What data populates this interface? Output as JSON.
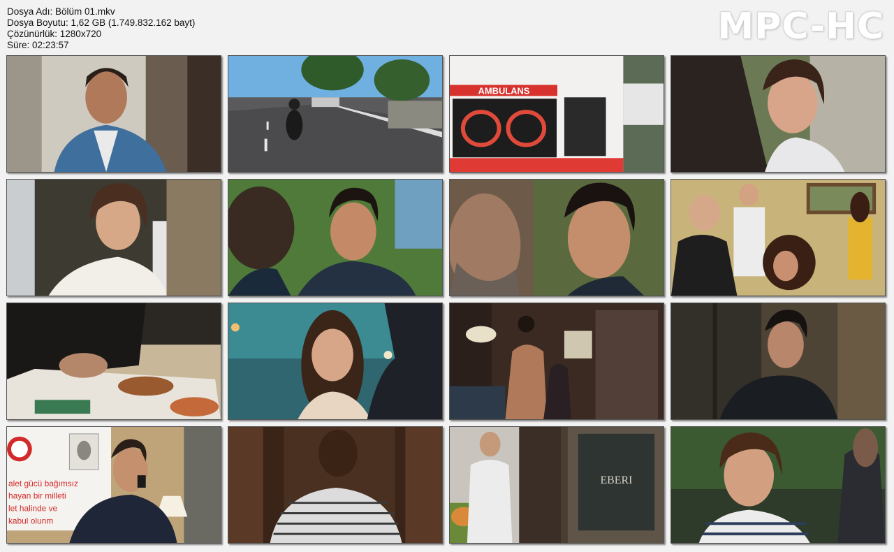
{
  "info": {
    "file_name": "Dosya Adı: Bölüm 01.mkv",
    "file_size": "Dosya Boyutu: 1,62 GB (1.749.832.162 bayt)",
    "resolution": "Çözünürlük: 1280x720",
    "duration": "Süre: 02:23:57"
  },
  "brand": "MPC-HC",
  "frames": [
    {
      "id": 1,
      "scene": "man-denim-shirt-indoors"
    },
    {
      "id": 2,
      "scene": "motorcycle-on-road",
      "bg": "#7fb3d8"
    },
    {
      "id": 3,
      "scene": "ambulance-rear",
      "sign": "AMBULANS"
    },
    {
      "id": 4,
      "scene": "woman-talking-outdoors"
    },
    {
      "id": 5,
      "scene": "woman-white-blouse"
    },
    {
      "id": 6,
      "scene": "two-men-facing"
    },
    {
      "id": 7,
      "scene": "man-closeup-conversation"
    },
    {
      "id": 8,
      "scene": "women-in-room"
    },
    {
      "id": 9,
      "scene": "hands-unwrapping-food"
    },
    {
      "id": 10,
      "scene": "woman-night-surprised"
    },
    {
      "id": 11,
      "scene": "shirtless-man-studio"
    },
    {
      "id": 12,
      "scene": "man-in-car"
    },
    {
      "id": 13,
      "scene": "man-on-phone-office",
      "wall_text": [
        "alet gücü bağımsız",
        "hayan bir milleti",
        "let halinde ve",
        "kabul olunm"
      ]
    },
    {
      "id": 14,
      "scene": "woman-striped-shirt-back"
    },
    {
      "id": 15,
      "scene": "man-by-doorway",
      "sign": "EBERI"
    },
    {
      "id": 16,
      "scene": "woman-striped-shirt-smiling"
    }
  ]
}
